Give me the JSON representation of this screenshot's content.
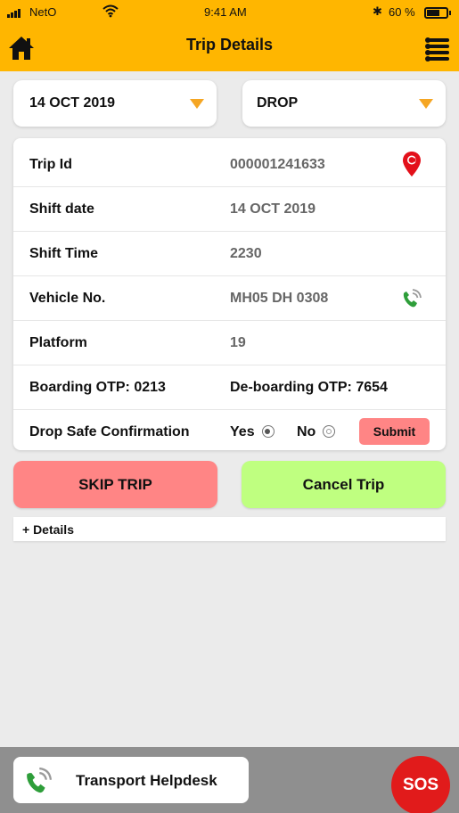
{
  "status_bar": {
    "carrier": "NetO",
    "time": "9:41 AM",
    "bluetooth": "✱",
    "battery_pct": "60 %",
    "battery_level": 0.6
  },
  "header": {
    "title": "Trip Details",
    "home_icon": "home-icon",
    "menu_icon": "list-menu-icon",
    "bg_color": "#ffb600"
  },
  "filters": {
    "date": "14 OCT 2019",
    "trip_type": "DROP",
    "arrow_color": "#f5a623"
  },
  "details": {
    "trip_id_label": "Trip Id",
    "trip_id_value": "000001241633",
    "shift_date_label": "Shift date",
    "shift_date_value": "14 OCT 2019",
    "shift_time_label": "Shift Time",
    "shift_time_value": "2230",
    "vehicle_label": "Vehicle No.",
    "vehicle_value": "MH05 DH 0308",
    "platform_label": "Platform",
    "platform_value": "19",
    "boarding_otp": "Boarding OTP: 0213",
    "deboarding_otp": "De-boarding OTP: 7654",
    "drop_safe_label": "Drop Safe Confirmation",
    "yes_label": "Yes",
    "no_label": "No",
    "selected": "Yes",
    "submit_label": "Submit"
  },
  "actions": {
    "skip_trip": "SKIP TRIP",
    "cancel_trip": "Cancel Trip",
    "skip_color": "#ff8585",
    "cancel_color": "#bfff80",
    "details_toggle": "+ Details"
  },
  "footer": {
    "helpdesk_label": "Transport Helpdesk",
    "sos_label": "SOS",
    "sos_color": "#e11b1b"
  }
}
